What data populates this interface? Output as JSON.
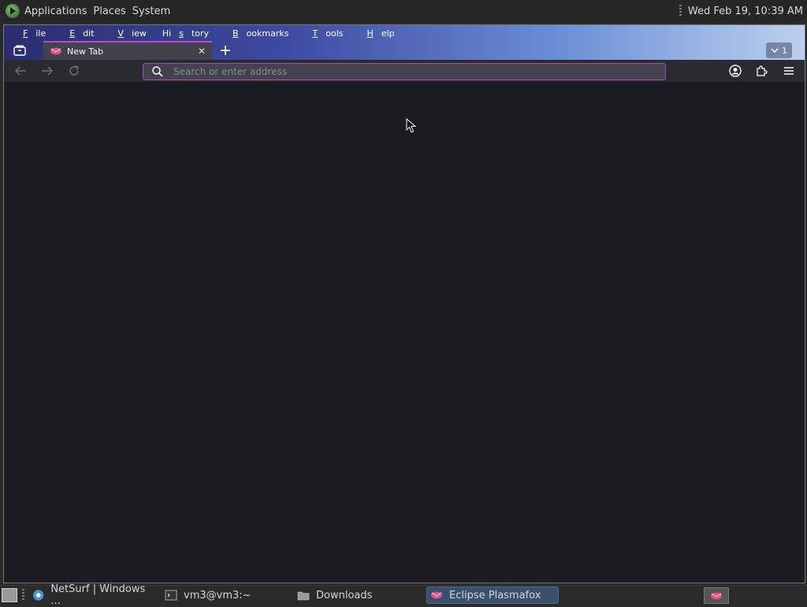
{
  "top_panel": {
    "menus": [
      "Applications",
      "Places",
      "System"
    ],
    "clock": "Wed Feb 19, 10:39 AM"
  },
  "browser": {
    "menubar": [
      {
        "pre": "",
        "ul": "F",
        "post": "ile"
      },
      {
        "pre": "",
        "ul": "E",
        "post": "dit"
      },
      {
        "pre": "",
        "ul": "V",
        "post": "iew"
      },
      {
        "pre": "Hi",
        "ul": "s",
        "post": "tory"
      },
      {
        "pre": "",
        "ul": "B",
        "post": "ookmarks"
      },
      {
        "pre": "",
        "ul": "T",
        "post": "ools"
      },
      {
        "pre": "",
        "ul": "H",
        "post": "elp"
      }
    ],
    "tab": {
      "title": "New Tab"
    },
    "tabs_count": "1",
    "urlbar": {
      "placeholder": "Search or enter address",
      "value": ""
    },
    "accent_color": "#b64bd0"
  },
  "taskbar": {
    "tasks": [
      {
        "label": "NetSurf | Windows ...",
        "icon": "globe-icon",
        "active": false
      },
      {
        "label": "vm3@vm3:~",
        "icon": "terminal-icon",
        "active": false
      },
      {
        "label": "Downloads",
        "icon": "folder-icon",
        "active": false
      },
      {
        "label": "Eclipse Plasmafox",
        "icon": "plasmafox-icon",
        "active": true
      }
    ]
  }
}
